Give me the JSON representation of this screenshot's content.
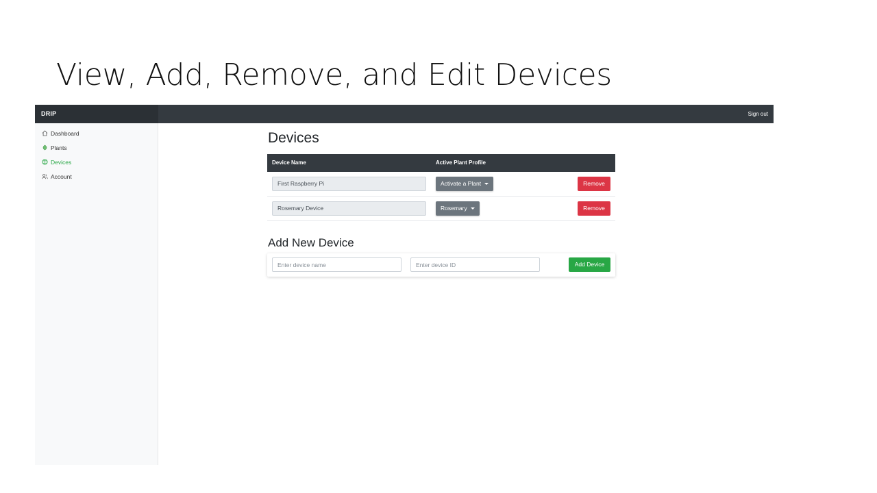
{
  "slide": {
    "title": "View, Add, Remove, and Edit Devices"
  },
  "app": {
    "brand": "DRIP",
    "signout_label": "Sign out",
    "colors": {
      "topbar": "#343a40",
      "active": "#28a745",
      "danger": "#dc3545",
      "success": "#28a745",
      "secondary": "#6c757d"
    }
  },
  "sidebar": {
    "items": [
      {
        "label": "Dashboard",
        "icon": "home-icon",
        "active": false
      },
      {
        "label": "Plants",
        "icon": "leaf-icon",
        "active": false
      },
      {
        "label": "Devices",
        "icon": "chip-icon",
        "active": true
      },
      {
        "label": "Account",
        "icon": "users-icon",
        "active": false
      }
    ]
  },
  "devices": {
    "heading": "Devices",
    "columns": [
      "Device Name",
      "Active Plant Profile"
    ],
    "rows": [
      {
        "name": "First Raspberry Pi",
        "profile": "Activate a Plant",
        "remove_label": "Remove"
      },
      {
        "name": "Rosemary Device",
        "profile": "Rosemary",
        "remove_label": "Remove"
      }
    ]
  },
  "add_device": {
    "heading": "Add New Device",
    "name_placeholder": "Enter device name",
    "id_placeholder": "Enter device ID",
    "button_label": "Add Device"
  }
}
